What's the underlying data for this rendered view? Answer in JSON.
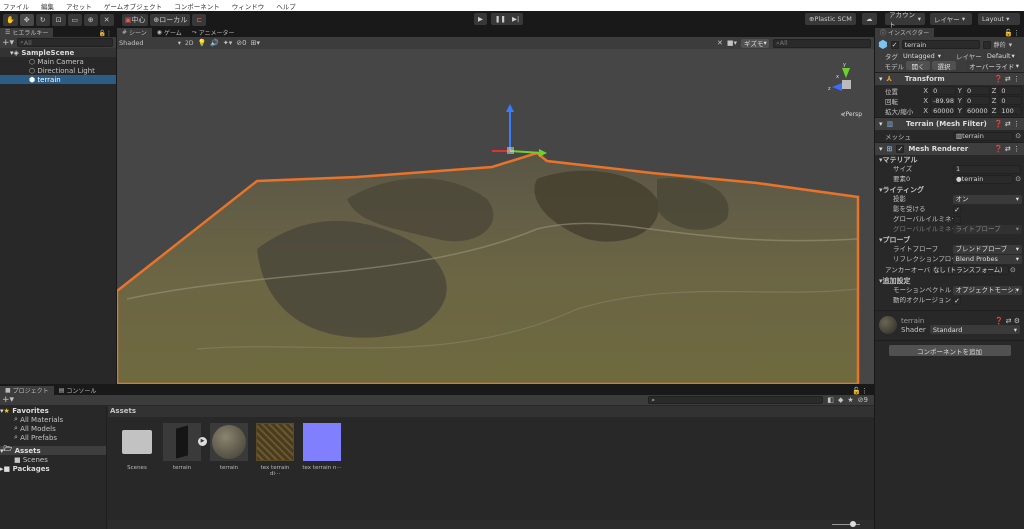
{
  "menu": [
    "ファイル",
    "編集",
    "アセット",
    "ゲームオブジェクト",
    "コンポーネント",
    "ウィンドウ",
    "ヘルプ"
  ],
  "toolbar": {
    "pivot": "中心",
    "space": "ローカル",
    "plastic": "Plastic SCM",
    "account": "アカウント",
    "layers": "レイヤー",
    "layout": "Layout"
  },
  "hierarchy": {
    "tab": "ヒエラルキー",
    "search_placeholder": "All",
    "scene": "SampleScene",
    "items": [
      "Main Camera",
      "Directional Light",
      "terrain"
    ]
  },
  "scene": {
    "tabs": [
      "シーン",
      "ゲーム",
      "アニメーター"
    ],
    "shading": "Shaded",
    "mode2d": "2D",
    "hidden_count": "0",
    "gizmos": "ギズモ",
    "search_placeholder": "All",
    "persp": "Persp",
    "axes": {
      "x": "x",
      "y": "y",
      "z": "z"
    }
  },
  "inspector": {
    "tab": "インスペクター",
    "name": "terrain",
    "static": "静的",
    "tag_label": "タグ",
    "tag": "Untagged",
    "layer_label": "レイヤー",
    "layer": "Default",
    "model_label": "モデル",
    "open": "開く",
    "select": "選択",
    "overrides": "オーバーライド",
    "transform": {
      "title": "Transform",
      "rows": [
        {
          "label": "位置",
          "x": "0",
          "y": "0",
          "z": "0"
        },
        {
          "label": "回転",
          "x": "-89.98",
          "y": "0",
          "z": "0"
        },
        {
          "label": "拡大/縮小",
          "x": "60000",
          "y": "60000",
          "z": "100"
        }
      ]
    },
    "mesh_filter": {
      "title": "Terrain (Mesh Filter)",
      "mesh_label": "メッシュ",
      "mesh": "terrain"
    },
    "mesh_renderer": {
      "title": "Mesh Renderer",
      "materials": "マテリアル",
      "size_label": "サイズ",
      "size": "1",
      "element_label": "要素0",
      "element": "terrain",
      "lighting": "ライティング",
      "cast_label": "投影",
      "cast": "オン",
      "receive_label": "影を受ける",
      "gi_label": "グローバルイルミネーシ",
      "gi2_label": "グローバルイルミネーシ",
      "gi2": "ライトプローブ",
      "probes": "プローブ",
      "light_probes_label": "ライトプローブ",
      "light_probes": "ブレンドプローブ",
      "reflection_label": "リフレクションプローブ",
      "reflection": "Blend Probes",
      "anchor_label": "アンカーオーバーライド",
      "anchor": "なし (トランスフォーム)",
      "additional": "追加設定",
      "motion_label": "モーションベクトル",
      "motion": "オブジェクトモーションごと",
      "occlusion_label": "動的オクルージョン"
    },
    "material": {
      "name": "terrain",
      "shader_label": "Shader",
      "shader": "Standard"
    },
    "add_component": "コンポーネントを追加"
  },
  "project": {
    "tabs": [
      "プロジェクト",
      "コンソール"
    ],
    "favorites": "Favorites",
    "fav_items": [
      "All Materials",
      "All Models",
      "All Prefabs"
    ],
    "assets": "Assets",
    "scenes": "Scenes",
    "packages": "Packages",
    "hidden_count": "9",
    "breadcrumb": "Assets",
    "assets_list": [
      "Scenes",
      "terrain",
      "terrain",
      "tex terrain di···",
      "tex terrain n···"
    ]
  }
}
